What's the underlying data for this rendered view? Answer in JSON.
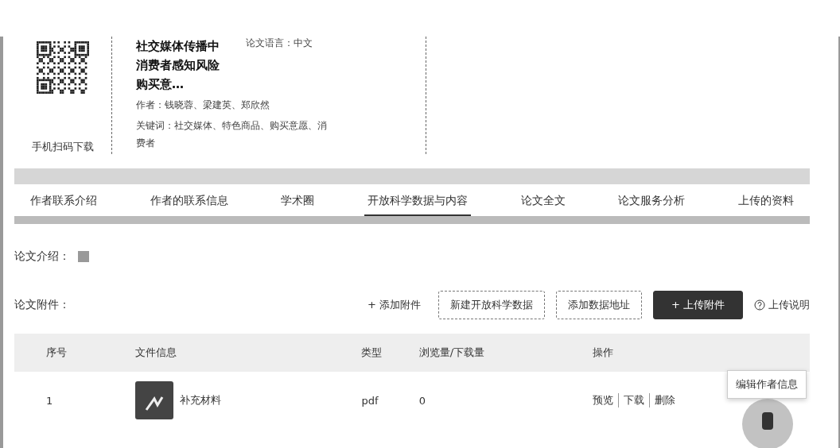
{
  "paper": {
    "qr_caption": "手机扫码下载",
    "title": "社交媒体传播中消费者感知风险购买意…",
    "language": "论文语言：中文",
    "authors": "作者：钱晓蓉、梁建英、郑欣然",
    "keywords": "关键词：社交媒体、特色商品、购买意愿、消费者"
  },
  "tabs": [
    {
      "label": "作者联系介绍",
      "selected": false
    },
    {
      "label": "作者的联系信息",
      "selected": false
    },
    {
      "label": "学术圈",
      "selected": false
    },
    {
      "label": "开放科学数据与内容",
      "selected": true
    },
    {
      "label": "论文全文",
      "selected": false
    },
    {
      "label": "论文服务分析",
      "selected": false
    },
    {
      "label": "上传的资料",
      "selected": false
    }
  ],
  "intro_label": "论文介绍：",
  "attachments": {
    "label": "论文附件：",
    "actions": [
      {
        "kind": "link",
        "label": "+ 添加附件"
      },
      {
        "kind": "outline",
        "label": "新建开放科学数据"
      },
      {
        "kind": "outline",
        "label": "添加数据地址"
      },
      {
        "kind": "primary",
        "label": "+ 上传附件"
      },
      {
        "kind": "help",
        "label": "上传说明"
      }
    ]
  },
  "table": {
    "columns": [
      "序号",
      "文件信息",
      "类型",
      "浏览量/下载量",
      "操作"
    ],
    "rows": [
      {
        "index": "1",
        "name": "补充材料",
        "type": "pdf",
        "views": "0",
        "actions": [
          "预览",
          "下载",
          "删除"
        ]
      }
    ]
  },
  "tooltip": "编辑作者信息"
}
